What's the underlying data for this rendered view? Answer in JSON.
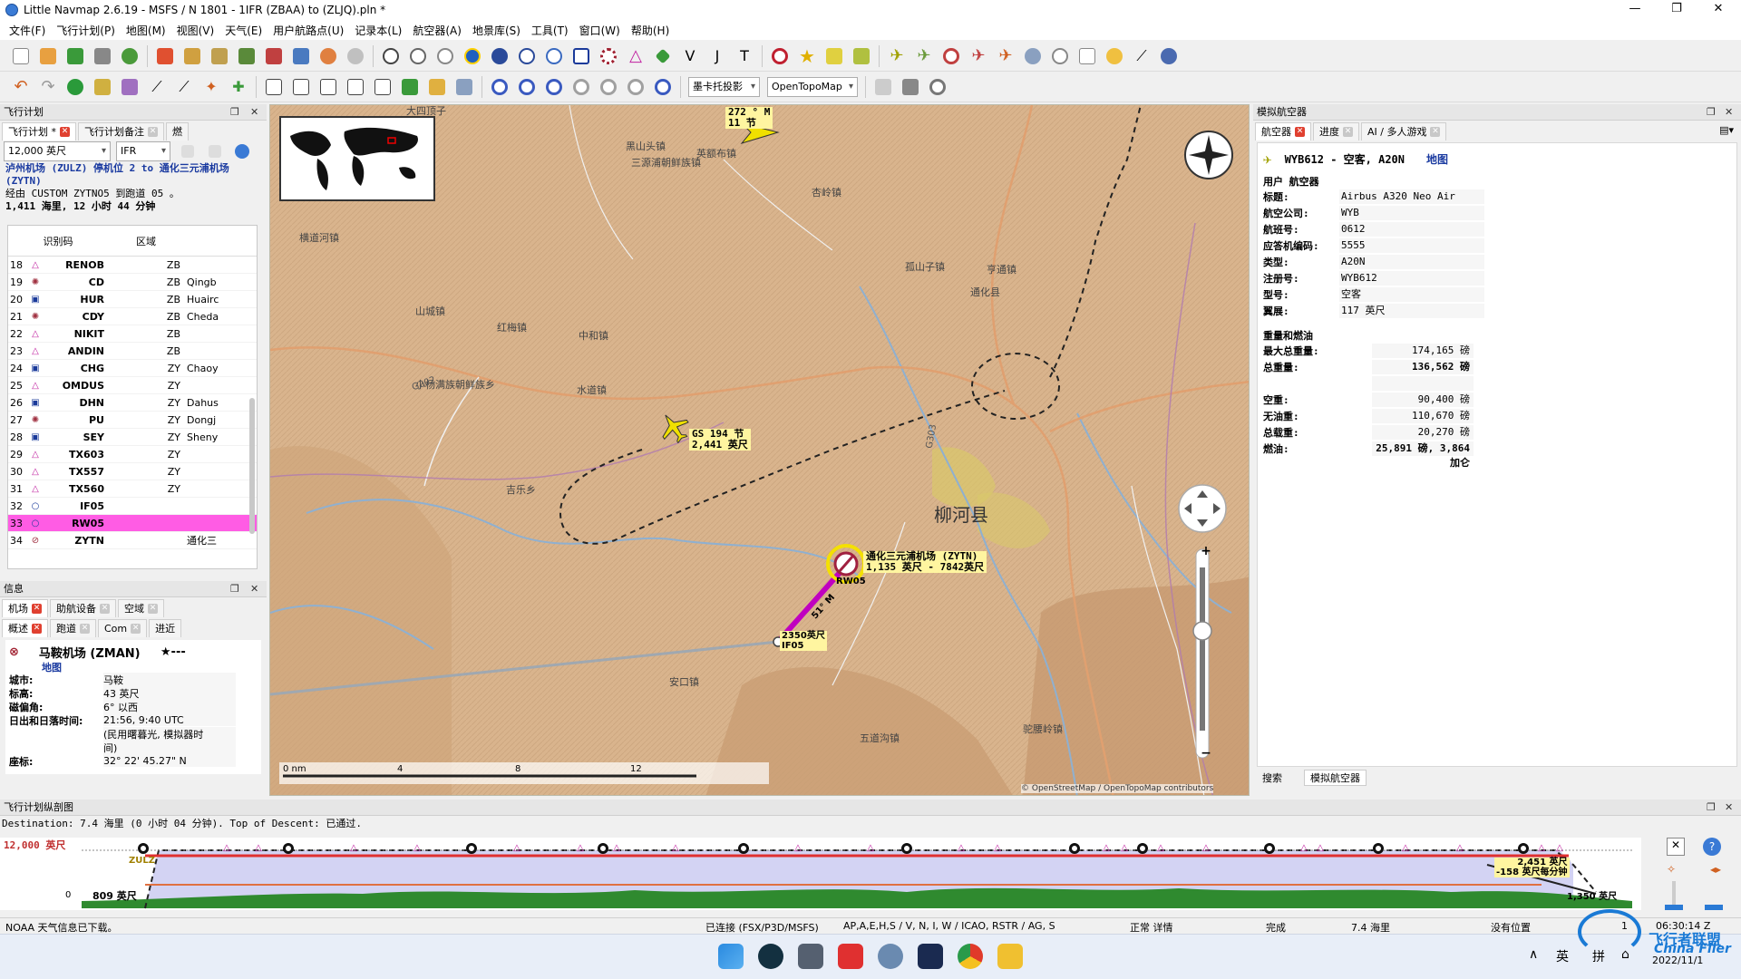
{
  "window": {
    "title": "Little Navmap 2.6.19 - MSFS / N 1801 - 1IFR  (ZBAA) to  (ZLJQ).pln *",
    "minimize": "—",
    "maximize": "❐",
    "close": "✕"
  },
  "menu": [
    "文件(F)",
    "飞行计划(P)",
    "地图(M)",
    "视图(V)",
    "天气(E)",
    "用户航路点(U)",
    "记录本(L)",
    "航空器(A)",
    "地景库(S)",
    "工具(T)",
    "窗口(W)",
    "帮助(H)"
  ],
  "toolbar2": {
    "projection_combo": "墨卡托投影",
    "theme_combo": "OpenTopoMap"
  },
  "flightplan_panel": {
    "title": "飞行计划",
    "tabs": [
      "飞行计划 *",
      "飞行计划备注",
      "燃"
    ],
    "altitude": "12,000 英尺",
    "flight_type": "IFR",
    "route_from": "泸州机场 (ZULZ)",
    "route_mid": " 停机位 2 to ",
    "route_to": "通化三元浦机场 (ZYTN)",
    "route_via": "经由 CUSTOM ZYTNO5 到跑道 05 。",
    "route_summary": "1,411 海里, 12 小时 44 分钟",
    "col_ident": "识别码",
    "col_region": "区域",
    "rows": [
      {
        "n": "18",
        "type": "wp",
        "ident": "RENOB",
        "region": "ZB",
        "name": ""
      },
      {
        "n": "19",
        "type": "ndb",
        "ident": "CD",
        "region": "ZB",
        "name": "Qingb"
      },
      {
        "n": "20",
        "type": "vor",
        "ident": "HUR",
        "region": "ZB",
        "name": "Huairc"
      },
      {
        "n": "21",
        "type": "ndb",
        "ident": "CDY",
        "region": "ZB",
        "name": "Cheda"
      },
      {
        "n": "22",
        "type": "wp",
        "ident": "NIKIT",
        "region": "ZB",
        "name": ""
      },
      {
        "n": "23",
        "type": "wp",
        "ident": "ANDIN",
        "region": "ZB",
        "name": ""
      },
      {
        "n": "24",
        "type": "vor",
        "ident": "CHG",
        "region": "ZY",
        "name": "Chaoy"
      },
      {
        "n": "25",
        "type": "wp",
        "ident": "OMDUS",
        "region": "ZY",
        "name": ""
      },
      {
        "n": "26",
        "type": "vor",
        "ident": "DHN",
        "region": "ZY",
        "name": "Dahus"
      },
      {
        "n": "27",
        "type": "ndb",
        "ident": "PU",
        "region": "ZY",
        "name": "Dongj"
      },
      {
        "n": "28",
        "type": "vor",
        "ident": "SEY",
        "region": "ZY",
        "name": "Sheny"
      },
      {
        "n": "29",
        "type": "wp",
        "ident": "TX603",
        "region": "ZY",
        "name": ""
      },
      {
        "n": "30",
        "type": "wp",
        "ident": "TX557",
        "region": "ZY",
        "name": ""
      },
      {
        "n": "31",
        "type": "wp",
        "ident": "TX560",
        "region": "ZY",
        "name": ""
      },
      {
        "n": "32",
        "type": "fix",
        "ident": "IF05",
        "region": "",
        "name": ""
      },
      {
        "n": "33",
        "type": "fix",
        "ident": "RW05",
        "region": "",
        "name": ""
      },
      {
        "n": "34",
        "type": "apt",
        "ident": "ZYTN",
        "region": "",
        "name": "通化三"
      }
    ]
  },
  "info_panel": {
    "title": "信息",
    "tabs1": [
      "机场",
      "助航设备",
      "空域"
    ],
    "tabs2": [
      "概述",
      "跑道",
      "Com",
      "进近"
    ],
    "airport_name": "马鞍机场 (ZMAN)",
    "rating": "★---",
    "map_link": "地图",
    "fields": [
      {
        "k": "城市:",
        "v": "马鞍"
      },
      {
        "k": "标高:",
        "v": "43 英尺"
      },
      {
        "k": "磁偏角:",
        "v": "6° 以西"
      },
      {
        "k": "日出和日落时间:",
        "v": "21:56, 9:40 UTC"
      },
      {
        "k": "",
        "v": "(民用曙暮光, 模拟器时"
      },
      {
        "k": "",
        "v": "间)"
      },
      {
        "k": "座标:",
        "v": "32° 22' 45.27\" N"
      }
    ]
  },
  "map": {
    "aircraft_label_1": "272 ° M",
    "aircraft_label_2": "11 节",
    "user_ac_label_1": "GS 194 节",
    "user_ac_label_2": "2,441 英尺",
    "airport_label": "通化三元浦机场 (ZYTN)",
    "airport_label_2": "1,135 英尺 - 7842英尺",
    "rwy_label": "RW05",
    "leg_label": "51° M",
    "if_label": "2350英尺",
    "if_label_2": "IF05",
    "big_town": "柳河县",
    "places": [
      "大四顶子",
      "英额布镇",
      "黑山头镇",
      "三源浦朝鲜族镇",
      "横道河镇",
      "杏岭镇",
      "孤山子镇",
      "山城镇",
      "红梅镇",
      "中和镇",
      "亨通镇",
      "通化县",
      "小杨满族朝鲜族乡",
      "水道镇",
      "吉乐乡",
      "安口镇",
      "驼腰岭镇",
      "五道沟镇"
    ],
    "road_labels": [
      "G202",
      "G303"
    ],
    "scale_0": "0 nm",
    "scale_4": "4",
    "scale_8": "8",
    "scale_12": "12",
    "attribution": "© OpenStreetMap / OpenTopoMap contributors"
  },
  "sim_panel": {
    "title": "模拟航空器",
    "tabs": [
      "航空器",
      "进度",
      "AI / 多人游戏"
    ],
    "header": "WYB612 - 空客, A20N",
    "map_link": "地图",
    "section_user": "用户 航空器",
    "fields": [
      {
        "k": "标题:",
        "v": "Airbus A320 Neo Air China"
      },
      {
        "k": "航空公司:",
        "v": "WYB"
      },
      {
        "k": "航班号:",
        "v": "0612"
      },
      {
        "k": "应答机编码:",
        "v": "5555"
      },
      {
        "k": "类型:",
        "v": "A20N"
      },
      {
        "k": "注册号:",
        "v": "WYB612"
      },
      {
        "k": "型号:",
        "v": "空客"
      },
      {
        "k": "翼展:",
        "v": "117 英尺"
      }
    ],
    "section_weight": "重量和燃油",
    "weights": [
      {
        "k": "最大总重量:",
        "v": "174,165 磅"
      },
      {
        "k": "总重量:",
        "v": "136,562 磅",
        "b": true
      },
      {
        "k": "",
        "v": ""
      },
      {
        "k": "空重:",
        "v": "90,400 磅"
      },
      {
        "k": "无油重:",
        "v": "110,670 磅"
      },
      {
        "k": "总载重:",
        "v": "20,270 磅"
      },
      {
        "k": "燃油:",
        "v": "25,891 磅, 3,864 加仑",
        "b": true
      }
    ],
    "bottom_tabs": [
      "搜索",
      "模拟航空器"
    ]
  },
  "profile": {
    "title": "飞行计划纵剖图",
    "destination_text": "Destination: 7.4 海里 (0 小时 04 分钟). Top of Descent: 已通过.",
    "alt_top": "12,000 英尺",
    "alt_low": "809 英尺",
    "zero": "0",
    "zulz": "ZULZ",
    "right_label_1": "2,451 英尺",
    "right_label_2": "-158 英尺每分钟",
    "right_label_3": "1,350 英尺"
  },
  "status": {
    "left": "NOAA 天气信息已下载。",
    "conn": "已连接 (FSX/P3D/MSFS)",
    "flags": "AP,A,E,H,S / V, N, I, W / ICAO, RSTR / AG, S",
    "detail": "正常 详情",
    "done": "完成",
    "dist": "7.4 海里",
    "pos": "没有位置",
    "count": "1",
    "time": "06:30:14 Z"
  },
  "taskbar": {
    "ime1": "英",
    "ime2": "拼",
    "date": "2022/11/1",
    "watermark": "飞行者联盟",
    "watermark_en": "China Flier"
  }
}
